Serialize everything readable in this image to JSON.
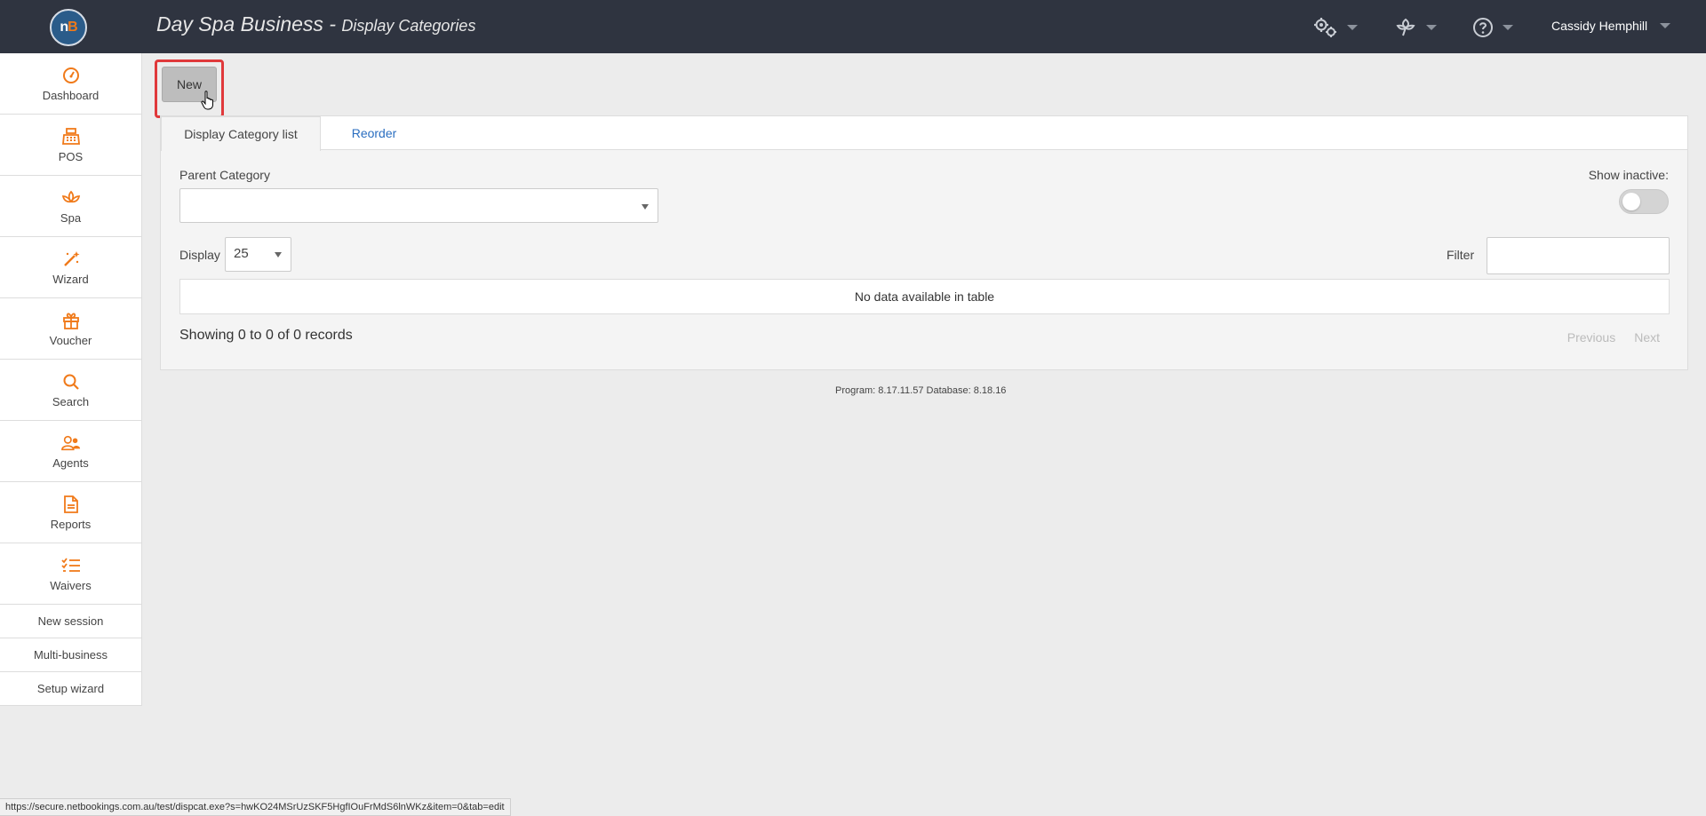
{
  "header": {
    "logo_text": "nB",
    "title_main": "Day Spa Business -",
    "title_sub": "Display Categories",
    "settings_icon": "gears-icon",
    "cloud_icon": "flower-icon",
    "help_icon": "help-circle-icon",
    "user_name": "Cassidy Hemphill"
  },
  "sidebar": {
    "items": [
      {
        "label": "Dashboard",
        "icon": "dashboard-icon"
      },
      {
        "label": "POS",
        "icon": "cash-register-icon"
      },
      {
        "label": "Spa",
        "icon": "lotus-icon"
      },
      {
        "label": "Wizard",
        "icon": "magic-wand-icon"
      },
      {
        "label": "Voucher",
        "icon": "gift-icon"
      },
      {
        "label": "Search",
        "icon": "search-icon"
      },
      {
        "label": "Agents",
        "icon": "users-icon"
      },
      {
        "label": "Reports",
        "icon": "document-icon"
      },
      {
        "label": "Waivers",
        "icon": "checklist-icon"
      }
    ],
    "links": [
      "New session",
      "Multi-business",
      "Setup wizard"
    ]
  },
  "toolbar": {
    "new_label": "New"
  },
  "tabs": [
    {
      "label": "Display Category list",
      "active": true
    },
    {
      "label": "Reorder",
      "active": false
    }
  ],
  "filters": {
    "parent_category_label": "Parent Category",
    "parent_category_value": "",
    "show_inactive_label": "Show inactive:",
    "show_inactive_on": false,
    "display_label": "Display",
    "display_value": "25",
    "filter_label": "Filter",
    "filter_value": ""
  },
  "table": {
    "empty_message": "No data available in table",
    "records_text": "Showing 0 to 0 of 0 records",
    "previous_label": "Previous",
    "next_label": "Next"
  },
  "footer": {
    "version_text": "Program: 8.17.11.57 Database: 8.18.16"
  },
  "statusbar": {
    "url": "https://secure.netbookings.com.au/test/dispcat.exe?s=hwKO24MSrUzSKF5HgfIOuFrMdS6lnWKz&item=0&tab=edit"
  },
  "colors": {
    "topbar": "#2f3440",
    "accent_orange": "#f07a1a",
    "link_blue": "#2a6ec0",
    "highlight_red": "#e0393b"
  }
}
